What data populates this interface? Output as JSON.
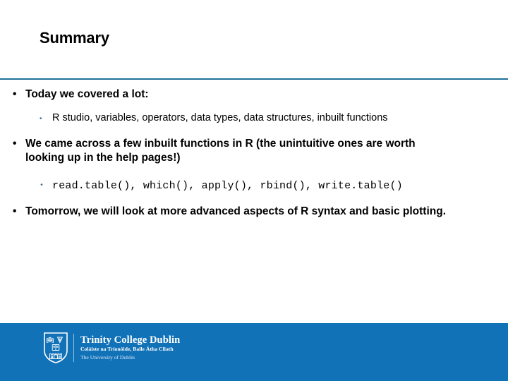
{
  "slide": {
    "title": "Summary",
    "colors": {
      "rule": "#1F7096",
      "footer_band": "#1272B8",
      "sub_bullet": "#4A6A8A",
      "background": "#FFFFFF"
    },
    "bullets": [
      {
        "level": 1,
        "marker": "•",
        "text": "Today we covered a lot:"
      },
      {
        "level": 2,
        "marker": "•",
        "style": "text",
        "text": "R studio, variables, operators, data types, data structures, inbuilt functions"
      },
      {
        "level": 1,
        "marker": "•",
        "text": "We came across a few inbuilt functions in R (the unintuitive ones are worth looking up in the help pages!)"
      },
      {
        "level": 2,
        "marker": "•",
        "style": "code",
        "text": "read.table(), which(), apply(), rbind(), write.table()"
      },
      {
        "level": 1,
        "marker": "•",
        "text": "Tomorrow, we will look at more advanced aspects of R syntax and basic plotting."
      }
    ]
  },
  "footer": {
    "logo": {
      "crest_name": "trinity-college-dublin-crest",
      "line1": "Trinity College Dublin",
      "line2": "Coláiste na Tríonóide, Baile Átha Cliath",
      "line3": "The University of Dublin"
    }
  }
}
